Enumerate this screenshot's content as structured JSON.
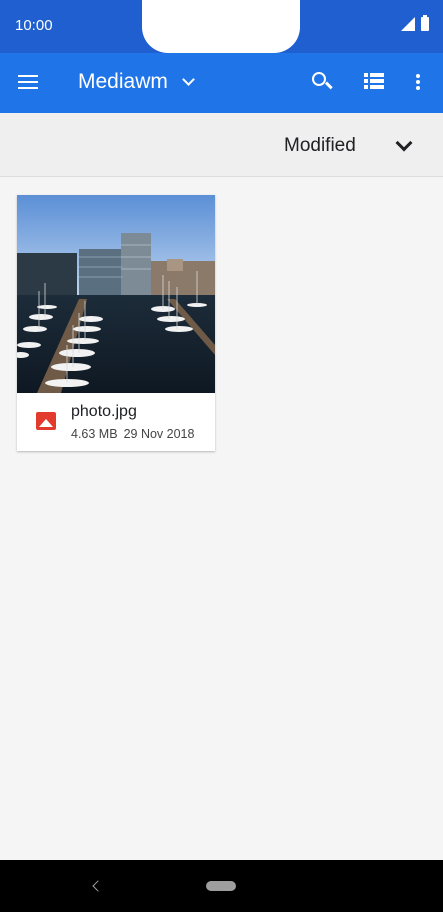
{
  "status_bar": {
    "time": "10:00",
    "icons": [
      "signal-icon",
      "battery-icon"
    ]
  },
  "app_bar": {
    "title": "Mediawm",
    "icons": [
      "menu-icon",
      "chevron-down-icon",
      "search-icon",
      "list-view-icon",
      "more-vert-icon"
    ],
    "color": "#1f74e8"
  },
  "sort_bar": {
    "label": "Modified"
  },
  "files": [
    {
      "name": "photo.jpg",
      "size": "4.63 MB",
      "date": "29 Nov 2018",
      "icon": "image-icon",
      "icon_color": "#e23b2e"
    }
  ],
  "nav_bar": {
    "icons": [
      "back-icon",
      "home-pill-icon"
    ]
  }
}
